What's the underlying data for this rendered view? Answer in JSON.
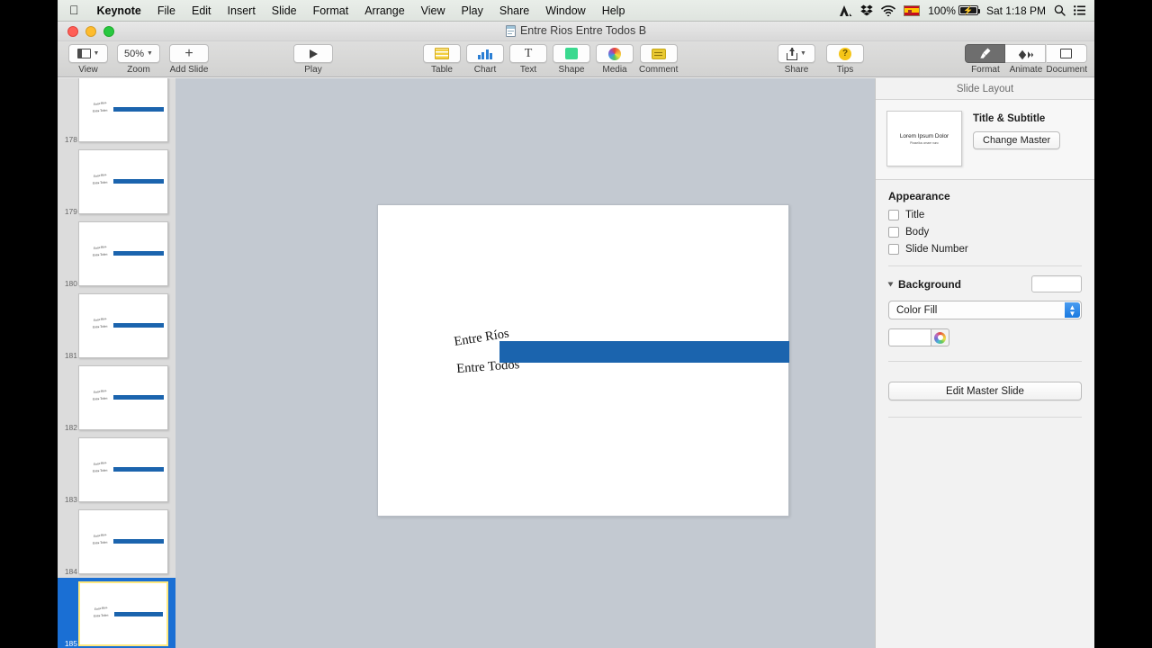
{
  "menubar": {
    "apple_icon": "apple-logo-icon",
    "items": [
      {
        "label": "Keynote",
        "bold": true
      },
      {
        "label": "File",
        "bold": false
      },
      {
        "label": "Edit",
        "bold": false
      },
      {
        "label": "Insert",
        "bold": false
      },
      {
        "label": "Slide",
        "bold": false
      },
      {
        "label": "Format",
        "bold": false
      },
      {
        "label": "Arrange",
        "bold": false
      },
      {
        "label": "View",
        "bold": false
      },
      {
        "label": "Play",
        "bold": false
      },
      {
        "label": "Share",
        "bold": false
      },
      {
        "label": "Window",
        "bold": false
      },
      {
        "label": "Help",
        "bold": false
      }
    ],
    "status": {
      "adobe_icon": "adobe-icon",
      "dropbox_icon": "dropbox-icon",
      "wifi_icon": "wifi-icon",
      "flag_icon": "spanish-flag-icon",
      "battery_percent": "100%",
      "battery_icon": "battery-charging-icon",
      "clock": "Sat 1:18 PM",
      "search_icon": "spotlight-search-icon",
      "notification_icon": "notification-center-icon"
    }
  },
  "titlebar": {
    "document_title": "Entre Rios Entre Todos B",
    "proxy_icon": "keynote-document-icon",
    "close_button": "close",
    "minimize_button": "minimize",
    "maximize_button": "maximize"
  },
  "toolbar": {
    "left": [
      {
        "label": "View",
        "icon": "view-layout-icon",
        "has_caret": true
      },
      {
        "label": "Zoom",
        "icon": "zoom-value",
        "value": "50%",
        "has_caret": true
      },
      {
        "label": "Add Slide",
        "icon": "plus-icon",
        "has_caret": false
      }
    ],
    "play": {
      "label": "Play",
      "icon": "play-triangle-icon"
    },
    "insert": [
      {
        "label": "Table",
        "icon": "table-icon"
      },
      {
        "label": "Chart",
        "icon": "chart-icon"
      },
      {
        "label": "Text",
        "icon": "text-t-icon"
      },
      {
        "label": "Shape",
        "icon": "shape-square-icon"
      },
      {
        "label": "Media",
        "icon": "media-photos-icon"
      },
      {
        "label": "Comment",
        "icon": "comment-note-icon"
      }
    ],
    "right": [
      {
        "label": "Share",
        "icon": "share-upload-icon",
        "has_caret": true
      },
      {
        "label": "Tips",
        "icon": "tips-question-icon",
        "has_caret": false
      }
    ],
    "inspector_tabs": [
      {
        "label": "Format",
        "icon": "paintbrush-icon",
        "active": true
      },
      {
        "label": "Animate",
        "icon": "animate-diamond-icon",
        "active": false
      },
      {
        "label": "Document",
        "icon": "document-rect-icon",
        "active": false
      }
    ]
  },
  "navigator": {
    "slides": [
      {
        "number": "178",
        "title_line1": "Entre Ríos",
        "title_line2": "Entre Todos",
        "selected": false
      },
      {
        "number": "179",
        "title_line1": "Entre Ríos",
        "title_line2": "Entre Todos",
        "selected": false
      },
      {
        "number": "180",
        "title_line1": "Entre Ríos",
        "title_line2": "Entre Todos",
        "selected": false
      },
      {
        "number": "181",
        "title_line1": "Entre Ríos",
        "title_line2": "Entre Todos",
        "selected": false
      },
      {
        "number": "182",
        "title_line1": "Entre Ríos",
        "title_line2": "Entre Todos",
        "selected": false
      },
      {
        "number": "183",
        "title_line1": "Entre Ríos",
        "title_line2": "Entre Todos",
        "selected": false
      },
      {
        "number": "184",
        "title_line1": "Entre Ríos",
        "title_line2": "Entre Todos",
        "selected": false
      },
      {
        "number": "185",
        "title_line1": "Entre Ríos",
        "title_line2": "Entre Todos",
        "selected": true
      }
    ]
  },
  "slide": {
    "text_line1": "Entre Ríos",
    "text_line2": "Entre Todos",
    "bar_color": "#1b64ae",
    "background_color": "#ffffff"
  },
  "inspector": {
    "panel_title": "Slide Layout",
    "master": {
      "name": "Title & Subtitle",
      "change_button": "Change Master",
      "thumb_title": "Lorem Ipsum Dolor",
      "thumb_subtitle": "Phasellus ornare nunc"
    },
    "appearance": {
      "heading": "Appearance",
      "options": [
        {
          "label": "Title",
          "checked": false
        },
        {
          "label": "Body",
          "checked": false
        },
        {
          "label": "Slide Number",
          "checked": false
        }
      ]
    },
    "background": {
      "heading": "Background",
      "fill_type": "Color Fill",
      "swatch_color": "#ffffff",
      "color_well": "#ffffff",
      "color_wheel_icon": "color-wheel-icon"
    },
    "edit_master_button": "Edit Master Slide"
  },
  "colors": {
    "accent_blue": "#1b64ae",
    "selection_blue": "#1a6fd4",
    "canvas_gray": "#c3c9d1",
    "navigator_gray": "#dcdcdc",
    "inspector_gray": "#f2f2f2"
  }
}
